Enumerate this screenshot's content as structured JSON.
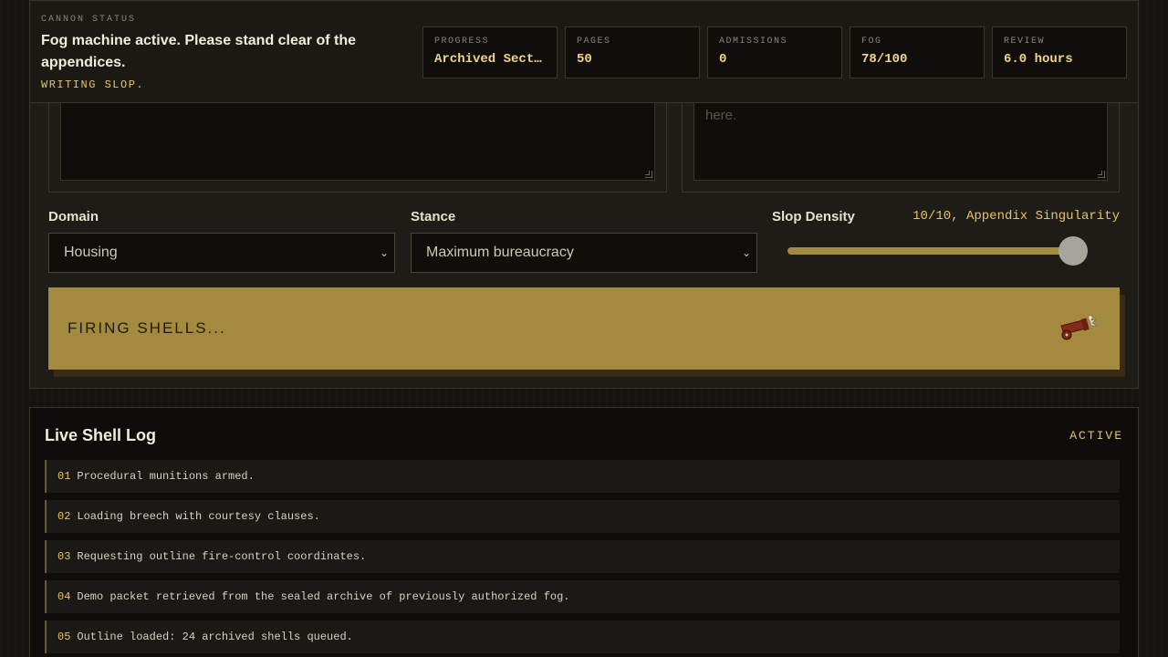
{
  "status": {
    "eyebrow": "CANNON STATUS",
    "title": "Fog machine active. Please stand clear of the appendices.",
    "subtitle": "WRITING SLOP.",
    "metrics": [
      {
        "label": "PROGRESS",
        "value": "Archived Sect…"
      },
      {
        "label": "PAGES",
        "value": "50"
      },
      {
        "label": "ADMISSIONS",
        "value": "0"
      },
      {
        "label": "FOG",
        "value": "78/100"
      },
      {
        "label": "REVIEW",
        "value": "6.0 hours"
      }
    ]
  },
  "form": {
    "left_textarea": {
      "placeholder": ""
    },
    "right_textarea": {
      "placeholder_visible": "here."
    },
    "domain": {
      "label": "Domain",
      "value": "Housing"
    },
    "stance": {
      "label": "Stance",
      "value": "Maximum bureaucracy"
    },
    "slop_density": {
      "label": "Slop Density",
      "value_text": "10/10, Appendix Singularity",
      "value": 10,
      "max": 10
    },
    "fire_button": {
      "label": "FIRING SHELLS...",
      "icon": "cannon-icon"
    }
  },
  "log": {
    "title": "Live Shell Log",
    "state": "ACTIVE",
    "entries": [
      {
        "num": "01",
        "text": "Procedural munitions armed."
      },
      {
        "num": "02",
        "text": "Loading breech with courtesy clauses."
      },
      {
        "num": "03",
        "text": "Requesting outline fire-control coordinates."
      },
      {
        "num": "04",
        "text": "Demo packet retrieved from the sealed archive of previously authorized fog."
      },
      {
        "num": "05",
        "text": "Outline loaded: 24 archived shells queued."
      }
    ]
  },
  "colors": {
    "accent": "#e7c46a",
    "button": "#a38a3f",
    "background": "#14130f",
    "panel": "#1e1c17"
  }
}
